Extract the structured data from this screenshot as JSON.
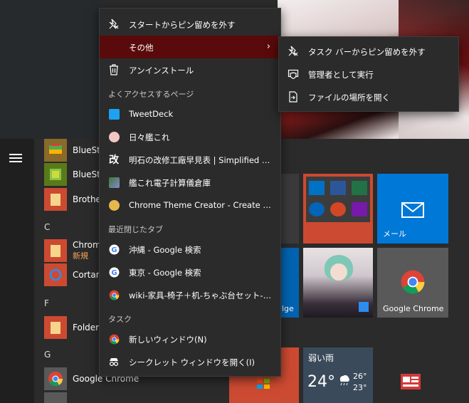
{
  "start_menu": {
    "apps": [
      {
        "label": "BlueStacks",
        "display": "BlueSta",
        "icon": "bluestacks-icon"
      },
      {
        "label": "BlueStacks",
        "display": "BlueSta",
        "icon": "bluestacks-icon"
      },
      {
        "label": "Brother",
        "display": "Brothe",
        "icon": "folder-icon"
      },
      {
        "label": "Chrome",
        "display": "Chrom",
        "sub": "新規",
        "icon": "folder-icon"
      },
      {
        "label": "Cortana",
        "display": "Cortan",
        "icon": "cortana-icon"
      },
      {
        "label": "Folderl",
        "display": "Folderl",
        "icon": "folder-icon"
      },
      {
        "label": "Google Chrome",
        "display": "Google Chrome",
        "icon": "chrome-icon"
      }
    ],
    "letters": {
      "c": "C",
      "f": "F",
      "g": "G"
    }
  },
  "tiles": {
    "mail_label": "メール",
    "edge_label": "lge",
    "chrome_label": "Google Chrome",
    "weather": {
      "condition": "弱い雨",
      "temp": "24°",
      "high": "26°",
      "low": "23°"
    }
  },
  "main_menu": {
    "unpin_start": "スタートからピン留めを外す",
    "more": "その他",
    "uninstall": "アンインストール",
    "frequent_header": "よくアクセスするページ",
    "frequent": [
      "TweetDeck",
      "日々艦これ",
      "明石の改修工廠早見表 | Simplified Ch...",
      "艦これ電子計算儀倉庫",
      "Chrome Theme Creator - Create Cust..."
    ],
    "recent_header": "最近閉じたタブ",
    "recent": [
      "沖縄 - Google 検索",
      "東京 - Google 検索",
      "wiki-家具-椅子＋机-ちゃぶ台セット-shop..."
    ],
    "tasks_header": "タスク",
    "tasks": [
      "新しいウィンドウ(N)",
      "シークレット ウィンドウを開く(I)"
    ]
  },
  "submenu": {
    "unpin_taskbar": "タスク バーからピン留めを外す",
    "run_admin": "管理者として実行",
    "open_location": "ファイルの場所を開く"
  },
  "colors": {
    "highlight": "#5a0a0a",
    "menu_bg": "#2b2b2b",
    "accent_orange": "#cc4a31",
    "mail_blue": "#0078d7"
  }
}
